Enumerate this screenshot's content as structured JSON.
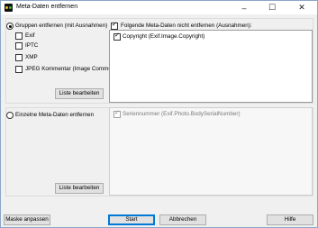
{
  "window": {
    "title": "Meta-Daten entfernen",
    "controls": {
      "minimize": "–",
      "maximize": "☐",
      "close": "✕"
    }
  },
  "group1": {
    "radio_label": "Gruppen entfernen (mit Ausnahmen)",
    "options": [
      {
        "label": "Exif",
        "checked": false
      },
      {
        "label": "IPTC",
        "checked": false
      },
      {
        "label": "XMP",
        "checked": false
      },
      {
        "label": "JPEG Kommentar (Image Comment)",
        "checked": false
      }
    ],
    "edit_button": "Liste bearbeiten",
    "exceptions_label": "Folgende Meta-Daten nicht entfernen (Ausnahmen):",
    "exceptions": [
      {
        "label": "Copyright (Exif.Image.Copyright)",
        "checked": true
      }
    ]
  },
  "group2": {
    "radio_label": "Einzelne Meta-Daten entfernen",
    "items": [
      {
        "label": "Seriennummer (Exif.Photo.BodySerialNumber)",
        "checked": true
      }
    ],
    "edit_button": "Liste bearbeiten"
  },
  "footer": {
    "mask_button": "Maske anpassen",
    "start_button": "Start",
    "cancel_button": "Abbrechen",
    "help_button": "Hilfe"
  }
}
